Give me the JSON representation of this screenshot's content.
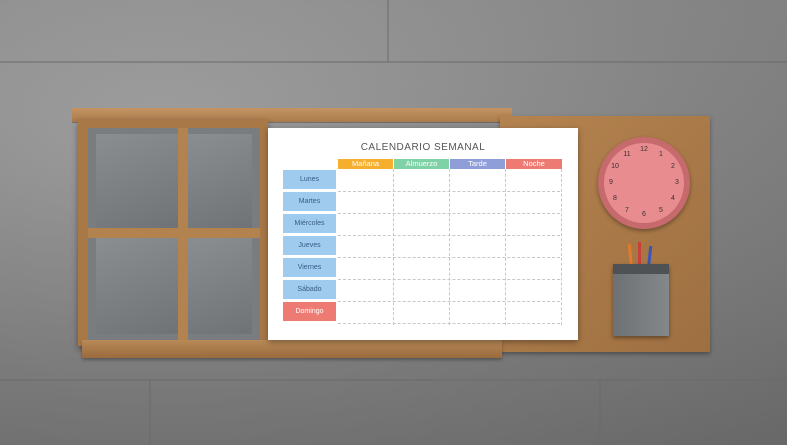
{
  "calendar": {
    "title": "CALENDARIO SEMANAL",
    "columns": [
      {
        "label": "Mañana",
        "color": "#f5ae2e"
      },
      {
        "label": "Almuerzo",
        "color": "#7fd1a6"
      },
      {
        "label": "Tarde",
        "color": "#8f9ed9"
      },
      {
        "label": "Noche",
        "color": "#ee7b73"
      }
    ],
    "days": [
      "Lunes",
      "Martes",
      "Miércoles",
      "Jueves",
      "Viernes",
      "Sábado",
      "Domingo"
    ]
  },
  "clock": {
    "numbers": [
      "12",
      "1",
      "2",
      "3",
      "4",
      "5",
      "6",
      "7",
      "8",
      "9",
      "10",
      "11"
    ]
  },
  "colors": {
    "wood": "#a97a4b",
    "marble": "#8a8a8a",
    "clock_face": "#e98c8f",
    "day_cell": "#9fcbef",
    "sunday_cell": "#ee7b73",
    "pencil_cup": "#7b7e80"
  }
}
